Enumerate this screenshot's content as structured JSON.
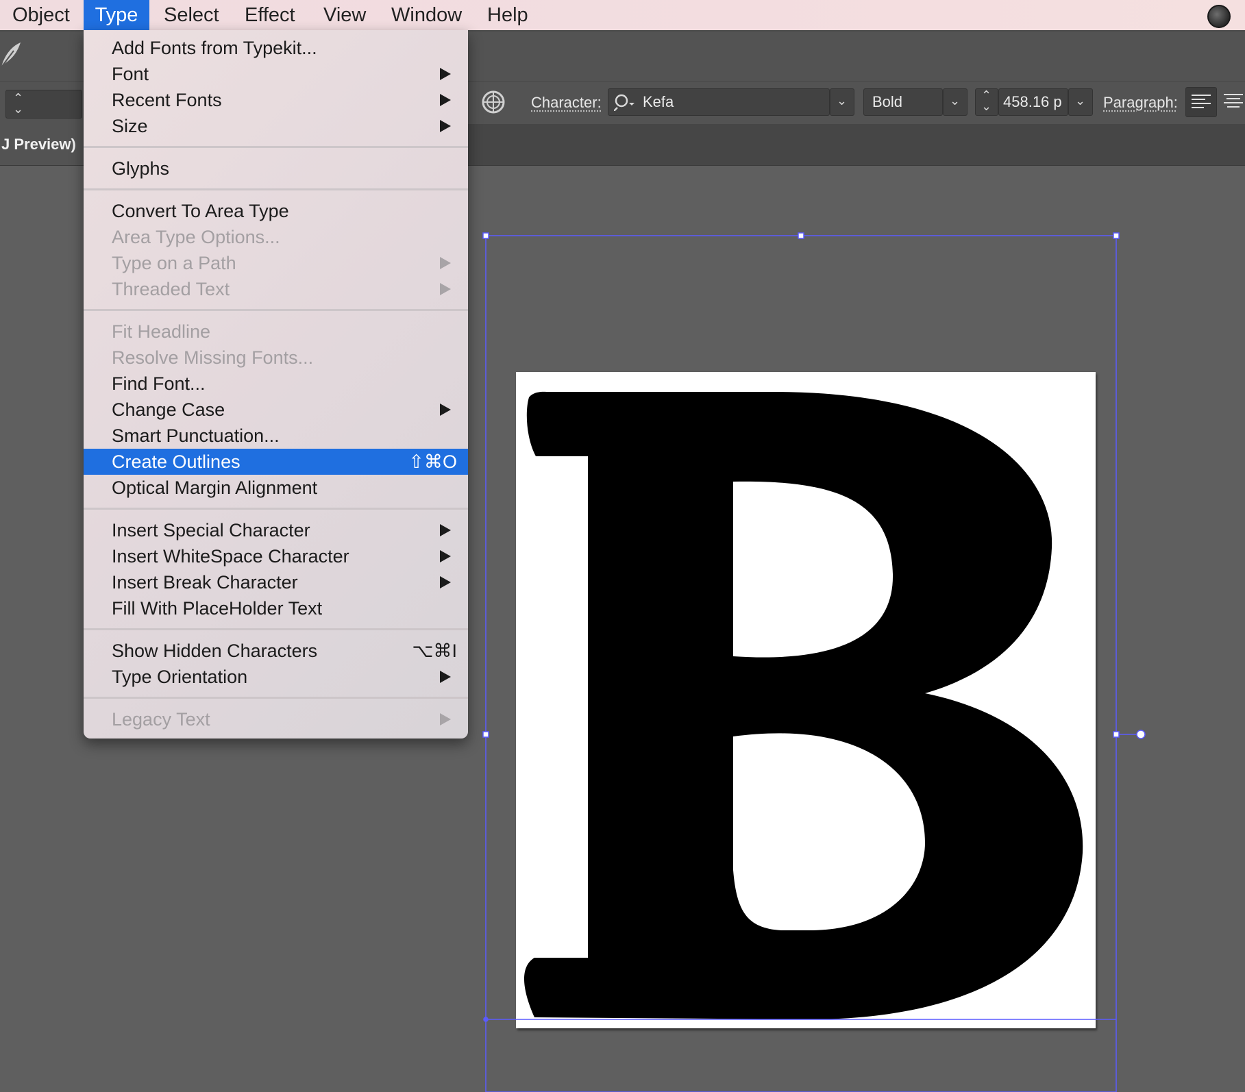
{
  "menubar": {
    "items": [
      "Object",
      "Type",
      "Select",
      "Effect",
      "View",
      "Window",
      "Help"
    ],
    "active": "Type"
  },
  "doc_tab": {
    "title": "J Preview)"
  },
  "control": {
    "character_label": "Character:",
    "font_name": "Kefa",
    "font_style": "Bold",
    "font_size": "458.16 p",
    "paragraph_label": "Paragraph:"
  },
  "type_menu": {
    "items": [
      {
        "label": "Add Fonts from Typekit...",
        "enabled": true,
        "submenu": false
      },
      {
        "label": "Font",
        "enabled": true,
        "submenu": true
      },
      {
        "label": "Recent Fonts",
        "enabled": true,
        "submenu": true
      },
      {
        "label": "Size",
        "enabled": true,
        "submenu": true
      },
      {
        "label": "Glyphs",
        "enabled": true,
        "submenu": false
      },
      {
        "label": "Convert To Area Type",
        "enabled": true,
        "submenu": false
      },
      {
        "label": "Area Type Options...",
        "enabled": false,
        "submenu": false
      },
      {
        "label": "Type on a Path",
        "enabled": false,
        "submenu": true
      },
      {
        "label": "Threaded Text",
        "enabled": false,
        "submenu": true
      },
      {
        "label": "Fit Headline",
        "enabled": false,
        "submenu": false
      },
      {
        "label": "Resolve Missing Fonts...",
        "enabled": false,
        "submenu": false
      },
      {
        "label": "Find Font...",
        "enabled": true,
        "submenu": false
      },
      {
        "label": "Change Case",
        "enabled": true,
        "submenu": true
      },
      {
        "label": "Smart Punctuation...",
        "enabled": true,
        "submenu": false
      },
      {
        "label": "Create Outlines",
        "enabled": true,
        "submenu": false,
        "shortcut": "⇧⌘O",
        "highlighted": true
      },
      {
        "label": "Optical Margin Alignment",
        "enabled": true,
        "submenu": false
      },
      {
        "label": "Insert Special Character",
        "enabled": true,
        "submenu": true
      },
      {
        "label": "Insert WhiteSpace Character",
        "enabled": true,
        "submenu": true
      },
      {
        "label": "Insert Break Character",
        "enabled": true,
        "submenu": true
      },
      {
        "label": "Fill With PlaceHolder Text",
        "enabled": true,
        "submenu": false
      },
      {
        "label": "Show Hidden Characters",
        "enabled": true,
        "submenu": false,
        "shortcut": "⌥⌘I"
      },
      {
        "label": "Type Orientation",
        "enabled": true,
        "submenu": true
      },
      {
        "label": "Legacy Text",
        "enabled": false,
        "submenu": true
      }
    ]
  },
  "canvas": {
    "glyph": "B",
    "selection_color": "#5b5bff",
    "highlight_color": "#1f6fe0"
  }
}
